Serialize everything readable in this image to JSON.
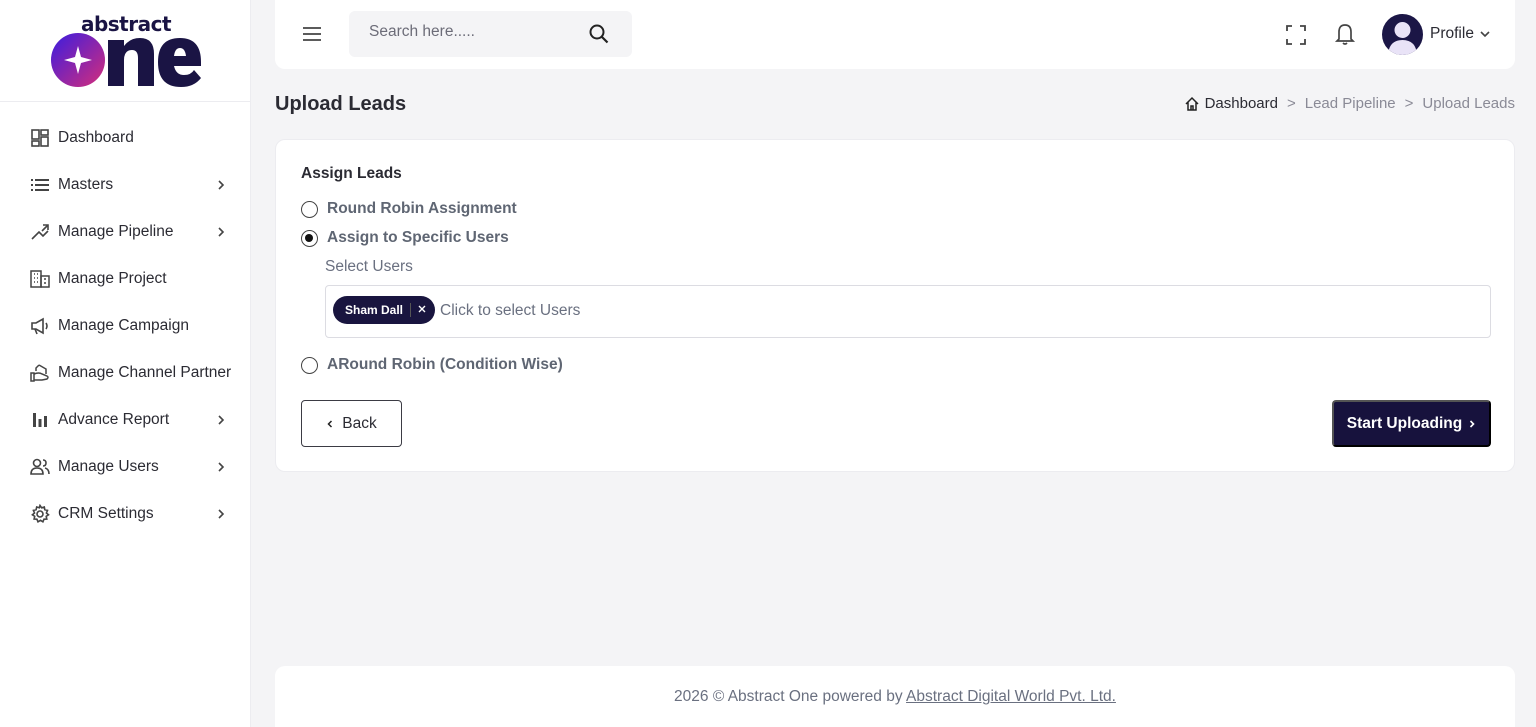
{
  "brand": {
    "logo_text_top": "abstract",
    "logo_text_main": "one",
    "colors": {
      "primary": "#17123d",
      "logo_gradient_start": "#3a1ce0",
      "logo_gradient_end": "#d62e7a"
    }
  },
  "sidebar": {
    "items": [
      {
        "label": "Dashboard",
        "icon": "dashboard-grid-icon",
        "has_submenu": false
      },
      {
        "label": "Masters",
        "icon": "list-icon",
        "has_submenu": true
      },
      {
        "label": "Manage Pipeline",
        "icon": "pipeline-route-icon",
        "has_submenu": true
      },
      {
        "label": "Manage Project",
        "icon": "building-icon",
        "has_submenu": false
      },
      {
        "label": "Manage Campaign",
        "icon": "megaphone-icon",
        "has_submenu": false
      },
      {
        "label": "Manage Channel Partner",
        "icon": "handshake-icon",
        "has_submenu": false
      },
      {
        "label": "Advance Report",
        "icon": "bar-chart-icon",
        "has_submenu": true
      },
      {
        "label": "Manage Users",
        "icon": "users-icon",
        "has_submenu": true
      },
      {
        "label": "CRM Settings",
        "icon": "gear-icon",
        "has_submenu": true
      }
    ]
  },
  "topbar": {
    "search_placeholder": "Search here.....",
    "profile_label": "Profile"
  },
  "page": {
    "title": "Upload Leads",
    "breadcrumb": {
      "home": "Dashboard",
      "sep": ">",
      "items": [
        "Lead Pipeline",
        "Upload Leads"
      ]
    }
  },
  "assign": {
    "heading": "Assign Leads",
    "options": [
      {
        "label": "Round Robin Assignment",
        "checked": false
      },
      {
        "label": "Assign to Specific Users",
        "checked": true
      },
      {
        "label": "ARound Robin (Condition Wise)",
        "checked": false
      }
    ],
    "select_label": "Select Users",
    "selected_users": [
      "Sham Dall"
    ],
    "select_placeholder": "Click to select Users"
  },
  "actions": {
    "back": "Back",
    "start": "Start Uploading"
  },
  "footer": {
    "text": "2026 © Abstract One powered by",
    "link": "Abstract Digital World Pvt. Ltd."
  }
}
